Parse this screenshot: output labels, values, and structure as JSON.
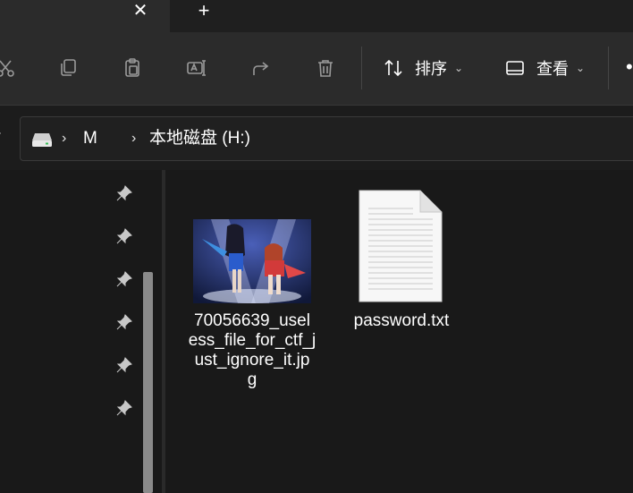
{
  "tabs": {
    "close_glyph": "✕",
    "new_tab_glyph": "+"
  },
  "toolbar": {
    "sort_label": "排序",
    "view_label": "查看",
    "more_glyph": "•",
    "icons": [
      "cut-icon",
      "copy-icon",
      "paste-icon",
      "rename-icon",
      "share-icon",
      "delete-icon"
    ]
  },
  "address": {
    "crumbs": [
      "M",
      "本地磁盘 (H:)"
    ],
    "separator": "›"
  },
  "files": [
    {
      "name_lines": [
        "70056639_usel",
        "ess_file_for_ctf_j",
        "ust_ignore_it.jp",
        "g"
      ],
      "type": "image"
    },
    {
      "name_lines": [
        "password.txt"
      ],
      "type": "text"
    }
  ],
  "colors": {
    "background": "#191919",
    "toolbar": "#2b2b2b",
    "accent": "#ffffff"
  }
}
